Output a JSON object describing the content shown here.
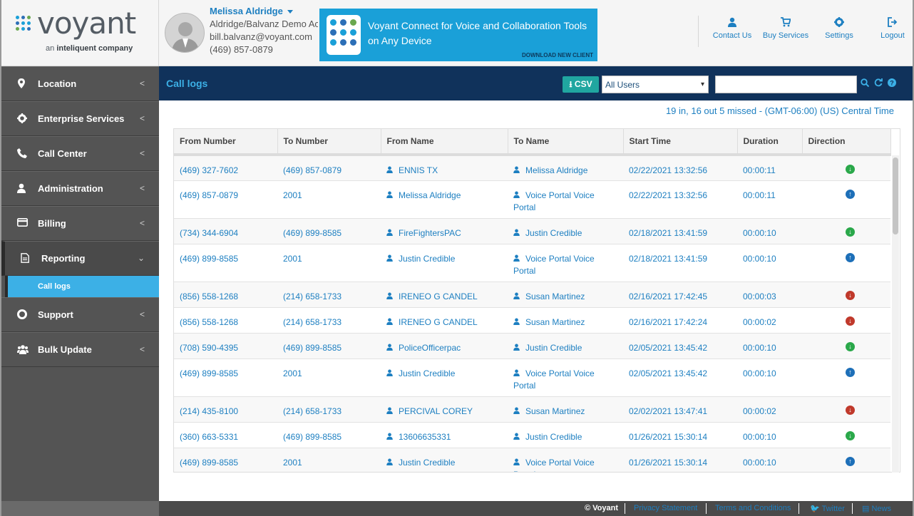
{
  "brand": {
    "logo_word": "voyant",
    "logo_tag_prefix": "an",
    "logo_tag_company": "inteliquent company"
  },
  "user": {
    "name": "Melissa Aldridge",
    "account": "Aldridge/Balvanz Demo Ac",
    "email": "bill.balvanz@voyant.com",
    "phone": "(469) 857-0879"
  },
  "banner": {
    "text": "Voyant Connect for Voice and Collaboration Tools on Any Device",
    "cta": "DOWNLOAD NEW CLIENT"
  },
  "top_nav": [
    {
      "label": "Contact Us",
      "icon": "user-icon"
    },
    {
      "label": "Buy Services",
      "icon": "cart-icon"
    },
    {
      "label": "Settings",
      "icon": "gear-icon"
    },
    {
      "label": "Logout",
      "icon": "logout-icon"
    }
  ],
  "sidebar": {
    "items": [
      {
        "label": "Location",
        "icon": "map-pin-icon"
      },
      {
        "label": "Enterprise Services",
        "icon": "gear-icon"
      },
      {
        "label": "Call Center",
        "icon": "phone-icon"
      },
      {
        "label": "Administration",
        "icon": "user-icon"
      },
      {
        "label": "Billing",
        "icon": "credit-card-icon"
      },
      {
        "label": "Reporting",
        "icon": "document-icon"
      },
      {
        "label": "Support",
        "icon": "lifebuoy-icon"
      },
      {
        "label": "Bulk Update",
        "icon": "users-icon"
      }
    ],
    "sub_item": "Call logs"
  },
  "page": {
    "title": "Call logs",
    "csv_label": "CSV",
    "user_filter": "All Users",
    "search_value": "",
    "summary": "19 in, 16 out 5 missed  - (GMT-06:00) (US) Central Time"
  },
  "table": {
    "headers": [
      "From Number",
      "To Number",
      "From Name",
      "To Name",
      "Start Time",
      "Duration",
      "Direction"
    ],
    "rows": [
      {
        "from_number": "(469) 327-7602",
        "to_number": "(469) 857-0879",
        "from_name": "ENNIS TX",
        "to_name": "Melissa Aldridge",
        "start": "02/22/2021 13:32:56",
        "duration": "00:00:11",
        "direction": "in"
      },
      {
        "from_number": "(469) 857-0879",
        "to_number": "2001",
        "from_name": "Melissa Aldridge",
        "to_name": "Voice Portal Voice Portal",
        "start": "02/22/2021 13:32:56",
        "duration": "00:00:11",
        "direction": "out"
      },
      {
        "from_number": "(734) 344-6904",
        "to_number": "(469) 899-8585",
        "from_name": "FireFightersPAC",
        "to_name": "Justin Credible",
        "start": "02/18/2021 13:41:59",
        "duration": "00:00:10",
        "direction": "in"
      },
      {
        "from_number": "(469) 899-8585",
        "to_number": "2001",
        "from_name": "Justin Credible",
        "to_name": "Voice Portal Voice Portal",
        "start": "02/18/2021 13:41:59",
        "duration": "00:00:10",
        "direction": "out"
      },
      {
        "from_number": "(856) 558-1268",
        "to_number": "(214) 658-1733",
        "from_name": "IRENEO G CANDEL",
        "to_name": "Susan Martinez",
        "start": "02/16/2021 17:42:45",
        "duration": "00:00:03",
        "direction": "missed"
      },
      {
        "from_number": "(856) 558-1268",
        "to_number": "(214) 658-1733",
        "from_name": "IRENEO G CANDEL",
        "to_name": "Susan Martinez",
        "start": "02/16/2021 17:42:24",
        "duration": "00:00:02",
        "direction": "missed"
      },
      {
        "from_number": "(708) 590-4395",
        "to_number": "(469) 899-8585",
        "from_name": "PoliceOfficerpac",
        "to_name": "Justin Credible",
        "start": "02/05/2021 13:45:42",
        "duration": "00:00:10",
        "direction": "in"
      },
      {
        "from_number": "(469) 899-8585",
        "to_number": "2001",
        "from_name": "Justin Credible",
        "to_name": "Voice Portal Voice Portal",
        "start": "02/05/2021 13:45:42",
        "duration": "00:00:10",
        "direction": "out"
      },
      {
        "from_number": "(214) 435-8100",
        "to_number": "(214) 658-1733",
        "from_name": "PERCIVAL COREY",
        "to_name": "Susan Martinez",
        "start": "02/02/2021 13:47:41",
        "duration": "00:00:02",
        "direction": "missed"
      },
      {
        "from_number": "(360) 663-5331",
        "to_number": "(469) 899-8585",
        "from_name": "13606635331",
        "to_name": "Justin Credible",
        "start": "01/26/2021 15:30:14",
        "duration": "00:00:10",
        "direction": "in"
      },
      {
        "from_number": "(469) 899-8585",
        "to_number": "2001",
        "from_name": "Justin Credible",
        "to_name": "Voice Portal Voice Portal",
        "start": "01/26/2021 15:30:14",
        "duration": "00:00:10",
        "direction": "out"
      }
    ]
  },
  "footer": {
    "copyright": "© Voyant",
    "links": [
      "Privacy Statement",
      "Terms and Conditions",
      "Twitter",
      "News"
    ]
  },
  "colors": {
    "accent": "#1d7fc1",
    "title_bar": "#10325b",
    "sidebar": "#545454",
    "active_sub": "#3cb0e6",
    "direction_in": "#2aa84a",
    "direction_out": "#1d6fb8",
    "direction_missed": "#c0392b"
  }
}
